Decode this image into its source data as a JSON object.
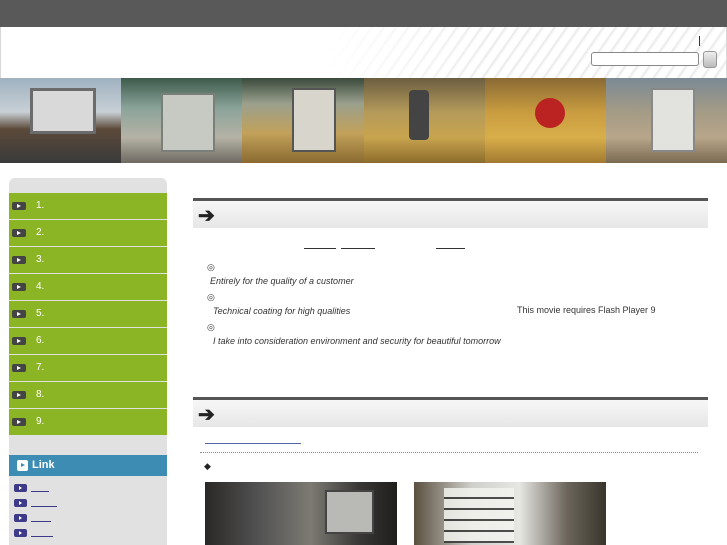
{
  "header": {
    "search_placeholder": "",
    "search_button_label": ""
  },
  "banner": {
    "photos": [
      "factory-exterior-photo",
      "paint-booth-photo",
      "coating-booth-photo",
      "spray-equipment-photo",
      "coating-rig-photo",
      "coated-panel-photo"
    ]
  },
  "sidebar": {
    "nav_items": [
      {
        "label": "1."
      },
      {
        "label": "2."
      },
      {
        "label": "3."
      },
      {
        "label": "4."
      },
      {
        "label": "5."
      },
      {
        "label": "6."
      },
      {
        "label": "7."
      },
      {
        "label": "8."
      },
      {
        "label": "9."
      }
    ],
    "link_heading": "Link",
    "links_count_shown": 4
  },
  "main": {
    "section1": {
      "bullet_symbol": "◎",
      "lines": [
        "Entirely for the quality of a customer",
        "Technical coating for high qualities",
        "I take into consideration environment and security for beautiful tomorrow"
      ],
      "flash_note": "This movie requires Flash Player 9"
    },
    "section2": {
      "diamond_symbol": "◆"
    }
  },
  "colors": {
    "nav_green": "#8cb525",
    "link_blue": "#3c8cb4",
    "top_bar": "#595959"
  }
}
